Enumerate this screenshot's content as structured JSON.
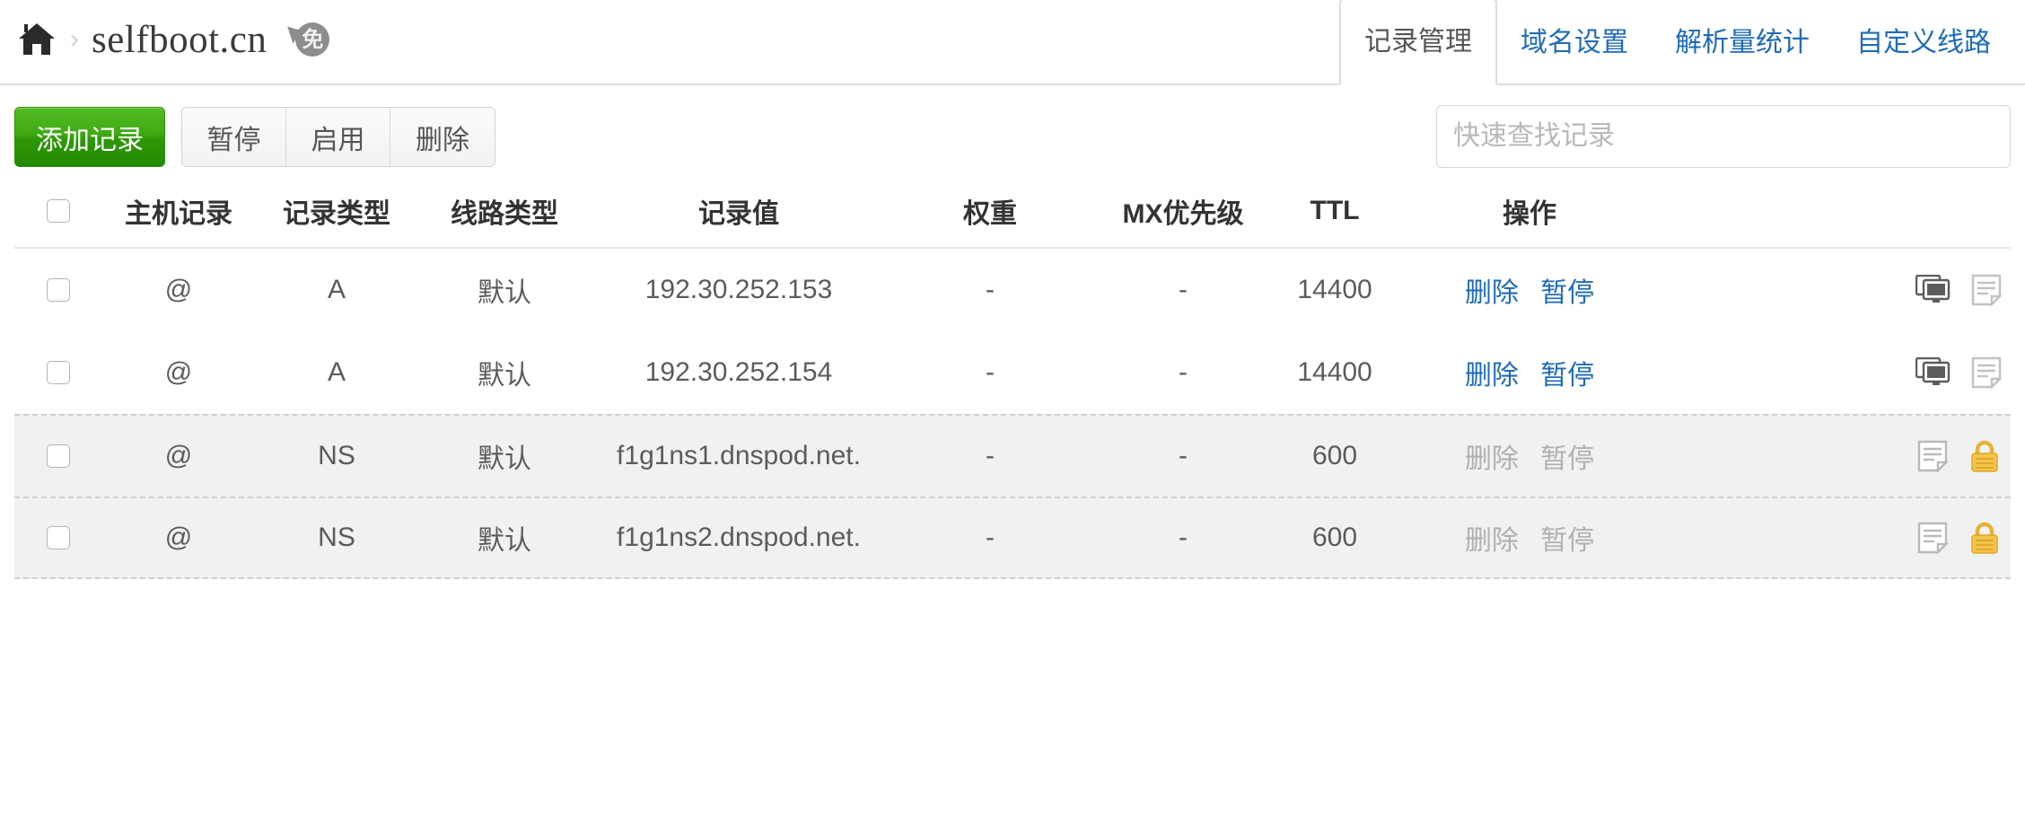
{
  "header": {
    "home_icon": "home-icon",
    "breadcrumb_separator": "›",
    "domain": "selfboot.cn",
    "free_badge_char": "免",
    "tabs": [
      {
        "label": "记录管理",
        "active": true
      },
      {
        "label": "域名设置",
        "active": false
      },
      {
        "label": "解析量统计",
        "active": false
      },
      {
        "label": "自定义线路",
        "active": false
      }
    ]
  },
  "toolbar": {
    "add_record_label": "添加记录",
    "group_buttons": [
      "暂停",
      "启用",
      "删除"
    ],
    "search_placeholder": "快速查找记录",
    "search_value": ""
  },
  "table": {
    "columns": [
      "",
      "主机记录",
      "记录类型",
      "线路类型",
      "记录值",
      "权重",
      "MX优先级",
      "TTL",
      "操作"
    ],
    "rows": [
      {
        "host": "@",
        "type": "A",
        "line": "默认",
        "value": "192.30.252.153",
        "weight": "-",
        "mx": "-",
        "ttl": "14400",
        "op_delete": "删除",
        "op_pause": "暂停",
        "ops_enabled": true,
        "icons": [
          "monitor-icon",
          "note-icon"
        ],
        "shaded": false
      },
      {
        "host": "@",
        "type": "A",
        "line": "默认",
        "value": "192.30.252.154",
        "weight": "-",
        "mx": "-",
        "ttl": "14400",
        "op_delete": "删除",
        "op_pause": "暂停",
        "ops_enabled": true,
        "icons": [
          "monitor-icon",
          "note-icon"
        ],
        "shaded": false
      },
      {
        "host": "@",
        "type": "NS",
        "line": "默认",
        "value": "f1g1ns1.dnspod.net.",
        "weight": "-",
        "mx": "-",
        "ttl": "600",
        "op_delete": "删除",
        "op_pause": "暂停",
        "ops_enabled": false,
        "icons": [
          "note-icon",
          "lock-icon"
        ],
        "shaded": true
      },
      {
        "host": "@",
        "type": "NS",
        "line": "默认",
        "value": "f1g1ns2.dnspod.net.",
        "weight": "-",
        "mx": "-",
        "ttl": "600",
        "op_delete": "删除",
        "op_pause": "暂停",
        "ops_enabled": false,
        "icons": [
          "note-icon",
          "lock-icon"
        ],
        "shaded": true
      }
    ]
  },
  "colors": {
    "link_blue": "#1f6bb8",
    "add_button_green": "#2d9806",
    "lock_yellow": "#f0bc3c",
    "shaded_row": "#f1f1f1",
    "disabled_text": "#b0b0b0"
  }
}
